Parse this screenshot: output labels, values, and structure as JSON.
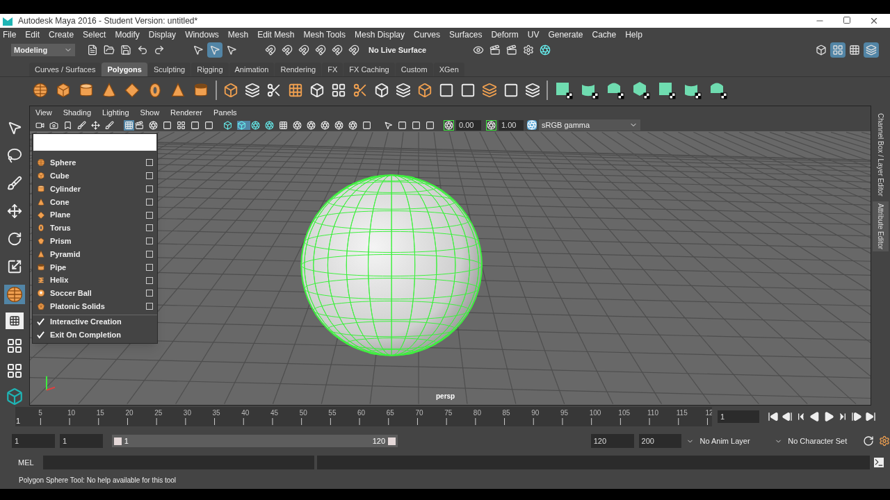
{
  "window": {
    "title": "Autodesk Maya 2016 - Student Version: untitled*"
  },
  "menu_bar": [
    "File",
    "Edit",
    "Create",
    "Select",
    "Modify",
    "Display",
    "Windows",
    "Mesh",
    "Edit Mesh",
    "Mesh Tools",
    "Mesh Display",
    "Curves",
    "Surfaces",
    "Deform",
    "UV",
    "Generate",
    "Cache",
    "Help"
  ],
  "toolbar": {
    "workspace": "Modeling",
    "live_surface": "No Live Surface"
  },
  "shelf": {
    "tabs": [
      {
        "label": "Curves / Surfaces",
        "selected": false
      },
      {
        "label": "Polygons",
        "selected": true
      },
      {
        "label": "Sculpting",
        "selected": false
      },
      {
        "label": "Rigging",
        "selected": false
      },
      {
        "label": "Animation",
        "selected": false
      },
      {
        "label": "Rendering",
        "selected": false
      },
      {
        "label": "FX",
        "selected": false
      },
      {
        "label": "FX Caching",
        "selected": false
      },
      {
        "label": "Custom",
        "selected": false
      },
      {
        "label": "XGen",
        "selected": false
      }
    ]
  },
  "toolbox": [
    {
      "selected": false
    },
    {
      "selected": false
    },
    {
      "selected": false
    },
    {
      "selected": false
    },
    {
      "selected": false
    },
    {
      "selected": false
    },
    {
      "selected": true
    }
  ],
  "viewport": {
    "menus": [
      "View",
      "Shading",
      "Lighting",
      "Show",
      "Renderer",
      "Panels"
    ],
    "exposure": "0.00",
    "gamma": "1.00",
    "color_space": "sRGB gamma",
    "camera": "persp"
  },
  "popup_menu": {
    "items": [
      {
        "kind": "primitive",
        "label": "Sphere"
      },
      {
        "kind": "primitive",
        "label": "Cube"
      },
      {
        "kind": "primitive",
        "label": "Cylinder"
      },
      {
        "kind": "primitive",
        "label": "Cone"
      },
      {
        "kind": "primitive",
        "label": "Plane"
      },
      {
        "kind": "primitive",
        "label": "Torus"
      },
      {
        "kind": "primitive",
        "label": "Prism"
      },
      {
        "kind": "primitive",
        "label": "Pyramid"
      },
      {
        "kind": "primitive",
        "label": "Pipe"
      },
      {
        "kind": "primitive",
        "label": "Helix"
      },
      {
        "kind": "primitive",
        "label": "Soccer Ball"
      },
      {
        "kind": "primitive",
        "label": "Platonic Solids"
      },
      {
        "kind": "toggle",
        "label": "Interactive Creation",
        "checked": true
      },
      {
        "kind": "toggle",
        "label": "Exit On Completion",
        "checked": true
      }
    ]
  },
  "side_tabs": [
    "Channel Box / Layer Editor",
    "Attribute Editor"
  ],
  "timeline": {
    "start_label": "1",
    "ticks": [
      "5",
      "10",
      "15",
      "20",
      "25",
      "30",
      "35",
      "40",
      "45",
      "50",
      "55",
      "60",
      "65",
      "70",
      "75",
      "80",
      "85",
      "90",
      "95",
      "100",
      "105",
      "110",
      "115",
      "12"
    ],
    "current_frame": "1"
  },
  "range": {
    "level": 1,
    "start": "1",
    "playback_start": "1",
    "slider_start": "1",
    "slider_end": "120",
    "playback_end": "120",
    "end": "200",
    "anim_layer": "No Anim Layer",
    "character_set": "No Character Set"
  },
  "command_line": {
    "label": "MEL"
  },
  "help_line": "Polygon Sphere Tool: No help available for this tool"
}
